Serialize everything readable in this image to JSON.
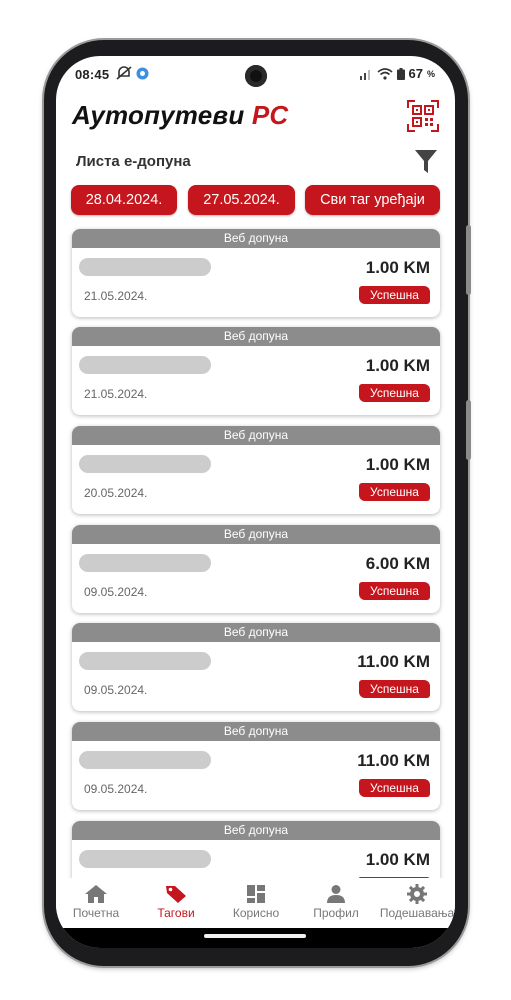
{
  "status_bar": {
    "time": "08:45",
    "battery": "67",
    "battery_unit": "%"
  },
  "header": {
    "app_title_main": "Аутопутеви",
    "app_title_accent": "РС"
  },
  "subheader": {
    "title": "Листа е-допуна"
  },
  "filters": {
    "date_from": "28.04.2024.",
    "date_to": "27.05.2024.",
    "devices": "Сви таг уређаји"
  },
  "transactions": [
    {
      "type": "Веб допуна",
      "amount": "1.00 KM",
      "date": "21.05.2024.",
      "status": "Успешна"
    },
    {
      "type": "Веб допуна",
      "amount": "1.00 KM",
      "date": "21.05.2024.",
      "status": "Успешна"
    },
    {
      "type": "Веб допуна",
      "amount": "1.00 KM",
      "date": "20.05.2024.",
      "status": "Успешна"
    },
    {
      "type": "Веб допуна",
      "amount": "6.00 KM",
      "date": "09.05.2024.",
      "status": "Успешна"
    },
    {
      "type": "Веб допуна",
      "amount": "11.00 KM",
      "date": "09.05.2024.",
      "status": "Успешна"
    },
    {
      "type": "Веб допуна",
      "amount": "11.00 KM",
      "date": "09.05.2024.",
      "status": "Успешна"
    },
    {
      "type": "Веб допуна",
      "amount": "1.00 KM",
      "date": "",
      "status": ""
    }
  ],
  "tabbar": {
    "items": [
      {
        "label": "Почетна",
        "icon": "home-icon"
      },
      {
        "label": "Тагови",
        "icon": "tag-icon"
      },
      {
        "label": "Корисно",
        "icon": "dashboard-icon"
      },
      {
        "label": "Профил",
        "icon": "profile-icon"
      },
      {
        "label": "Подешавања",
        "icon": "gear-icon"
      }
    ],
    "active_index": 1
  },
  "colors": {
    "brand_red": "#c4161c",
    "header_gray": "#8c8c8c",
    "placeholder_gray": "#cccccc"
  }
}
